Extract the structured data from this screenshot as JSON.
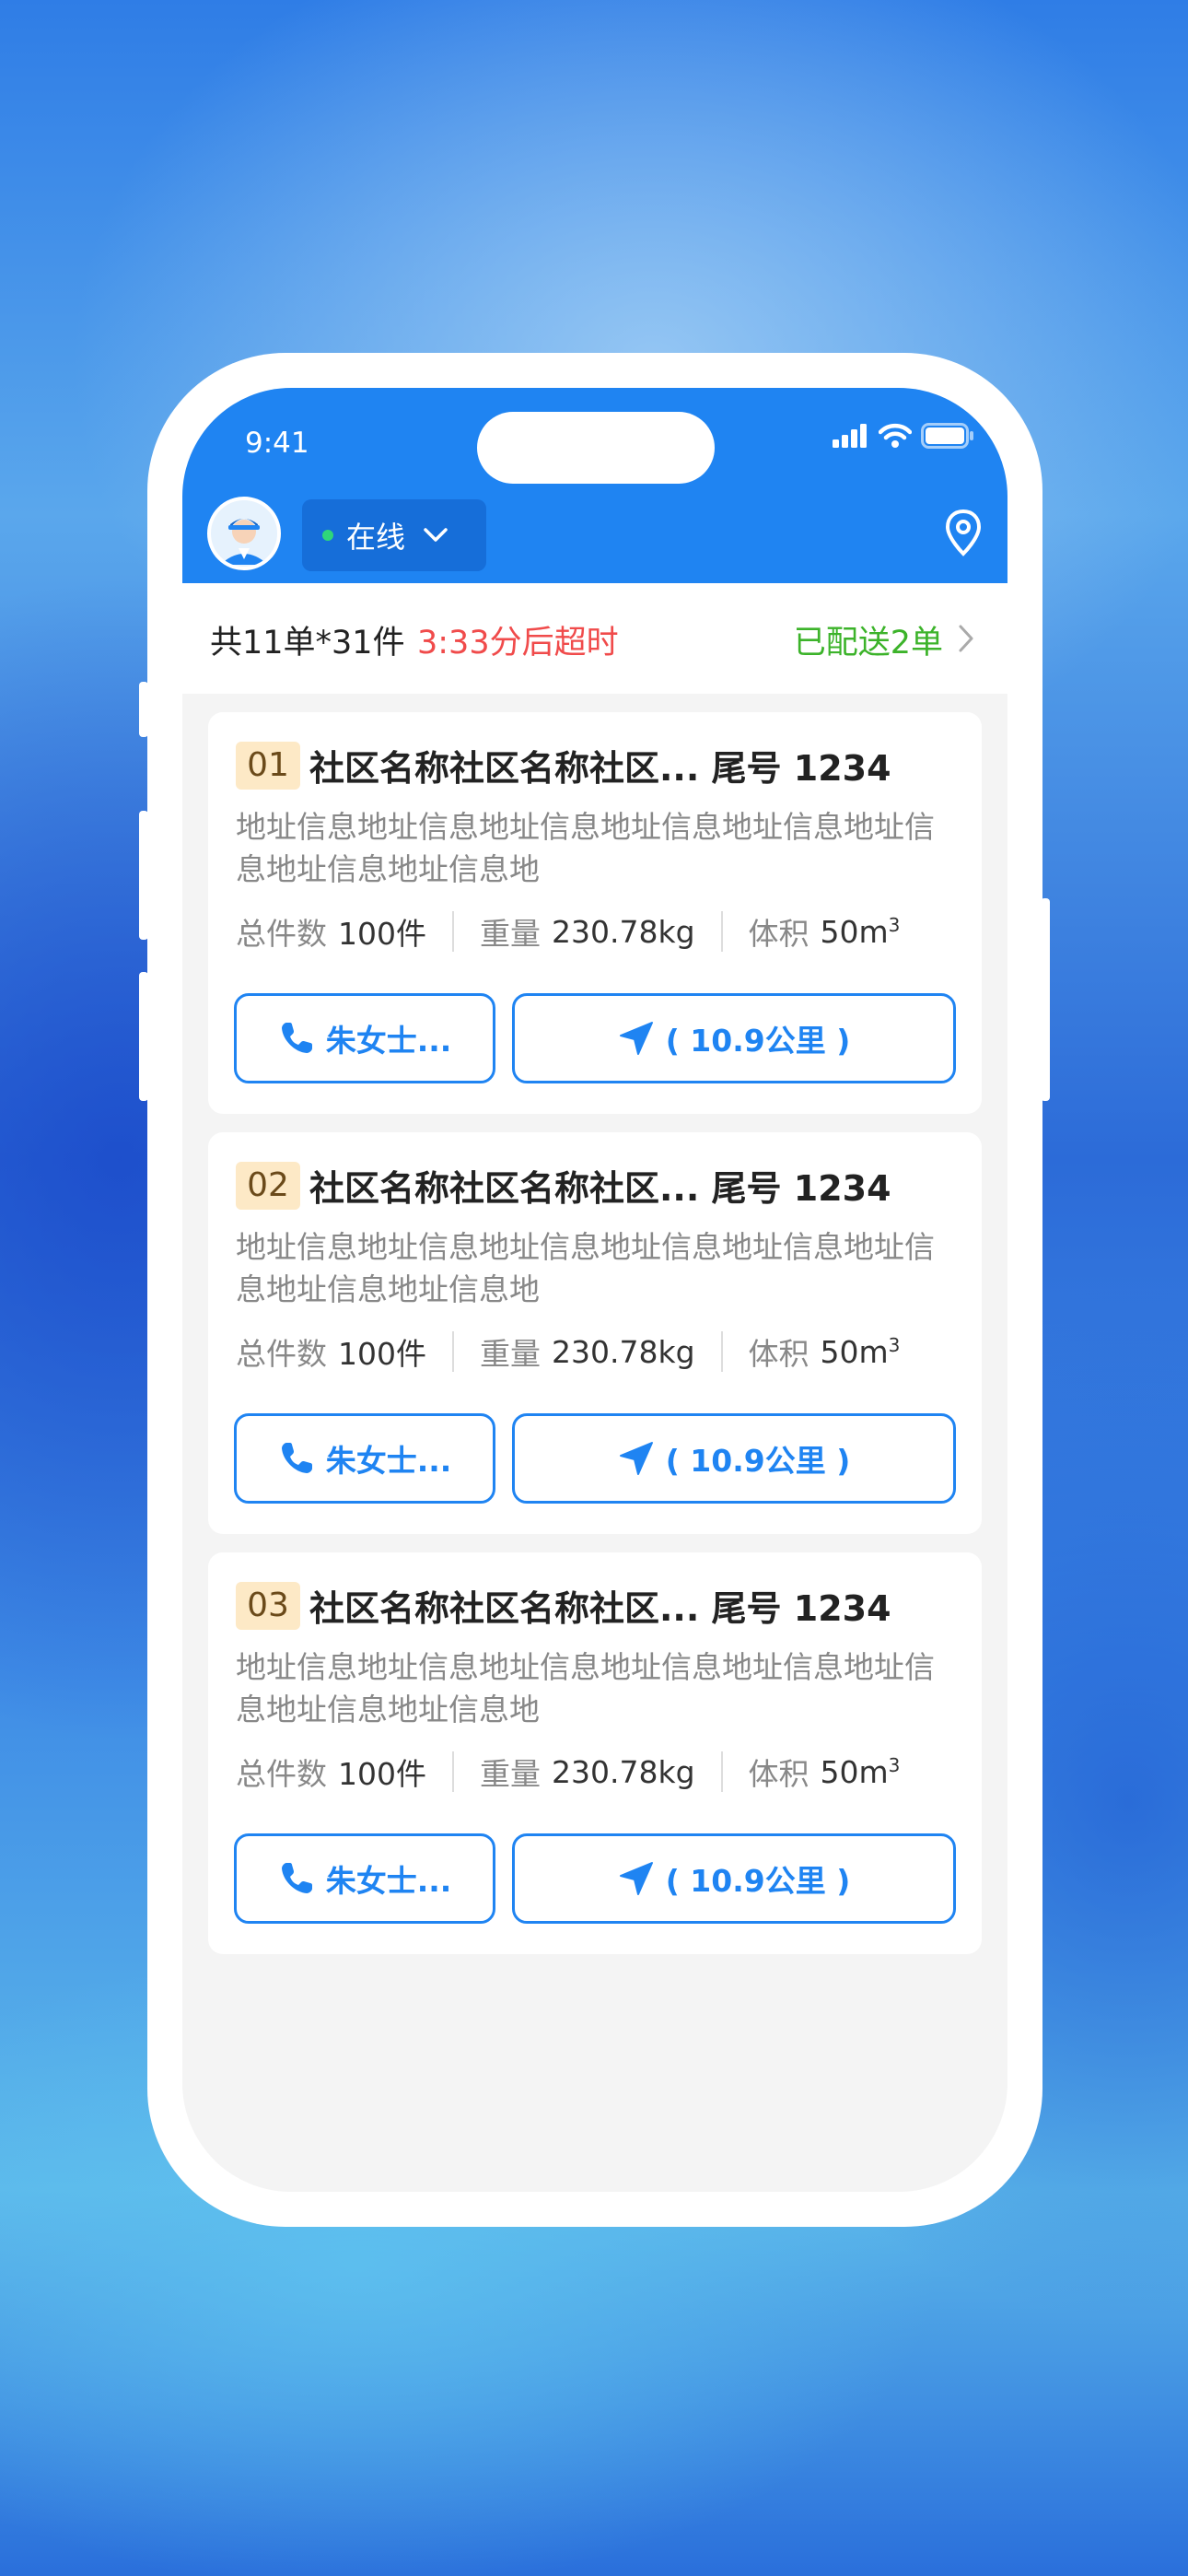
{
  "status_bar": {
    "time": "9:41"
  },
  "header": {
    "online_label": "在线"
  },
  "summary": {
    "counts": "共11单*31件",
    "timeout": "3:33分后超时",
    "delivered": "已配送2单"
  },
  "orders": [
    {
      "index": "01",
      "title": "社区名称社区名称社区...  尾号 1234",
      "address": "地址信息地址信息地址信息地址信息地址信息地址信息地址信息地址信息地",
      "count_label": "总件数",
      "count_value": "100件",
      "weight_label": "重量",
      "weight_value": "230.78kg",
      "volume_label": "体积",
      "volume_value": "50m",
      "contact": "朱女士...",
      "distance": "( 10.9公里 )"
    },
    {
      "index": "02",
      "title": "社区名称社区名称社区...  尾号 1234",
      "address": "地址信息地址信息地址信息地址信息地址信息地址信息地址信息地址信息地",
      "count_label": "总件数",
      "count_value": "100件",
      "weight_label": "重量",
      "weight_value": "230.78kg",
      "volume_label": "体积",
      "volume_value": "50m",
      "contact": "朱女士...",
      "distance": "( 10.9公里 )"
    },
    {
      "index": "03",
      "title": "社区名称社区名称社区...  尾号 1234",
      "address": "地址信息地址信息地址信息地址信息地址信息地址信息地址信息地址信息地",
      "count_label": "总件数",
      "count_value": "100件",
      "weight_label": "重量",
      "weight_value": "230.78kg",
      "volume_label": "体积",
      "volume_value": "50m",
      "contact": "朱女士...",
      "distance": "( 10.9公里 )"
    }
  ],
  "colors": {
    "primary": "#1f84f2",
    "timeout": "#f04b4b",
    "delivered": "#3cb32a",
    "badge": "#fde9c6"
  },
  "icons": [
    "signal-icon",
    "wifi-icon",
    "battery-icon",
    "avatar",
    "chevron-down-icon",
    "location-pin-icon",
    "chevron-right-icon",
    "phone-icon",
    "navigation-arrow-icon"
  ]
}
